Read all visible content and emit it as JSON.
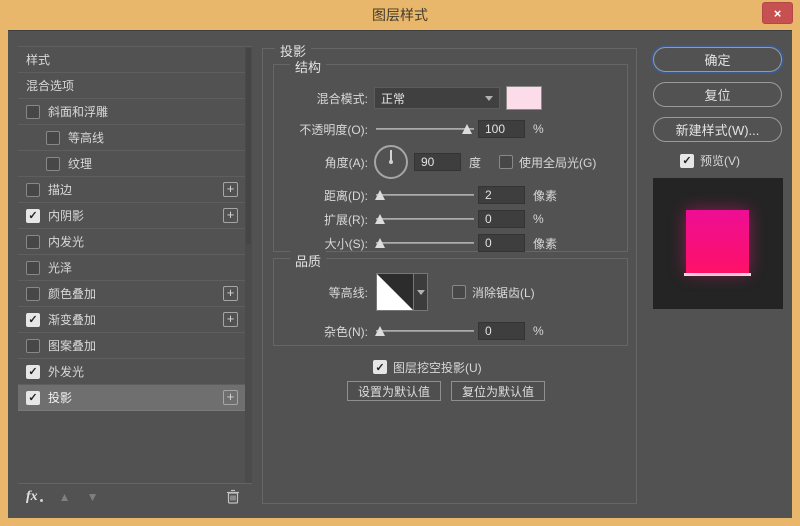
{
  "window": {
    "title": "图层样式",
    "close_label": "×"
  },
  "colors": {
    "frame": "#e8b76c",
    "dialog_bg": "#525252",
    "close_red": "#c75050",
    "ok_focus_ring": "#3c5a8c",
    "shadow_color_swatch": "#fbdce8",
    "preview_bg": "#242424",
    "preview_pink_top": "#ee0e95",
    "preview_pink_bottom": "#fe1168"
  },
  "sidebar": {
    "items": [
      {
        "label": "样式",
        "checkbox": false,
        "checked": false,
        "indent": false,
        "plus": false,
        "selected": false
      },
      {
        "label": "混合选项",
        "checkbox": false,
        "checked": false,
        "indent": false,
        "plus": false,
        "selected": false
      },
      {
        "label": "斜面和浮雕",
        "checkbox": true,
        "checked": false,
        "indent": false,
        "plus": false,
        "selected": false
      },
      {
        "label": "等高线",
        "checkbox": true,
        "checked": false,
        "indent": true,
        "plus": false,
        "selected": false
      },
      {
        "label": "纹理",
        "checkbox": true,
        "checked": false,
        "indent": true,
        "plus": false,
        "selected": false
      },
      {
        "label": "描边",
        "checkbox": true,
        "checked": false,
        "indent": false,
        "plus": true,
        "selected": false
      },
      {
        "label": "内阴影",
        "checkbox": true,
        "checked": true,
        "indent": false,
        "plus": true,
        "selected": false
      },
      {
        "label": "内发光",
        "checkbox": true,
        "checked": false,
        "indent": false,
        "plus": false,
        "selected": false
      },
      {
        "label": "光泽",
        "checkbox": true,
        "checked": false,
        "indent": false,
        "plus": false,
        "selected": false
      },
      {
        "label": "颜色叠加",
        "checkbox": true,
        "checked": false,
        "indent": false,
        "plus": true,
        "selected": false
      },
      {
        "label": "渐变叠加",
        "checkbox": true,
        "checked": true,
        "indent": false,
        "plus": true,
        "selected": false
      },
      {
        "label": "图案叠加",
        "checkbox": true,
        "checked": false,
        "indent": false,
        "plus": false,
        "selected": false
      },
      {
        "label": "外发光",
        "checkbox": true,
        "checked": true,
        "indent": false,
        "plus": false,
        "selected": false
      },
      {
        "label": "投影",
        "checkbox": true,
        "checked": true,
        "indent": false,
        "plus": true,
        "selected": true
      }
    ],
    "footer": {
      "fx_label": "fx",
      "check_glyph": "✓",
      "plus_glyph": "+",
      "up_arrow": "▲",
      "down_arrow": "▼"
    }
  },
  "main": {
    "panel_title": "投影",
    "structure": {
      "legend": "结构",
      "blend_mode": {
        "label": "混合模式:",
        "value": "正常"
      },
      "opacity": {
        "label": "不透明度(O):",
        "value": "100",
        "unit": "%",
        "slider_percent": 93
      },
      "angle": {
        "label": "角度(A):",
        "value": "90",
        "unit": "度",
        "global_light_label": "使用全局光(G)",
        "global_light_checked": false
      },
      "distance": {
        "label": "距离(D):",
        "value": "2",
        "unit": "像素",
        "slider_percent": 4
      },
      "spread": {
        "label": "扩展(R):",
        "value": "0",
        "unit": "%",
        "slider_percent": 4
      },
      "size": {
        "label": "大小(S):",
        "value": "0",
        "unit": "像素",
        "slider_percent": 4
      }
    },
    "quality": {
      "legend": "品质",
      "contour": {
        "label": "等高线:",
        "anti_alias_label": "消除锯齿(L)",
        "anti_alias_checked": false
      },
      "noise": {
        "label": "杂色(N):",
        "value": "0",
        "unit": "%",
        "slider_percent": 4
      }
    },
    "knockout": {
      "label": "图层挖空投影(U)",
      "checked": true
    },
    "buttons": {
      "make_default": "设置为默认值",
      "reset_default": "复位为默认值"
    }
  },
  "actions": {
    "ok": "确定",
    "reset": "复位",
    "new_style": "新建样式(W)...",
    "preview": {
      "label": "预览(V)",
      "checked": true
    }
  }
}
